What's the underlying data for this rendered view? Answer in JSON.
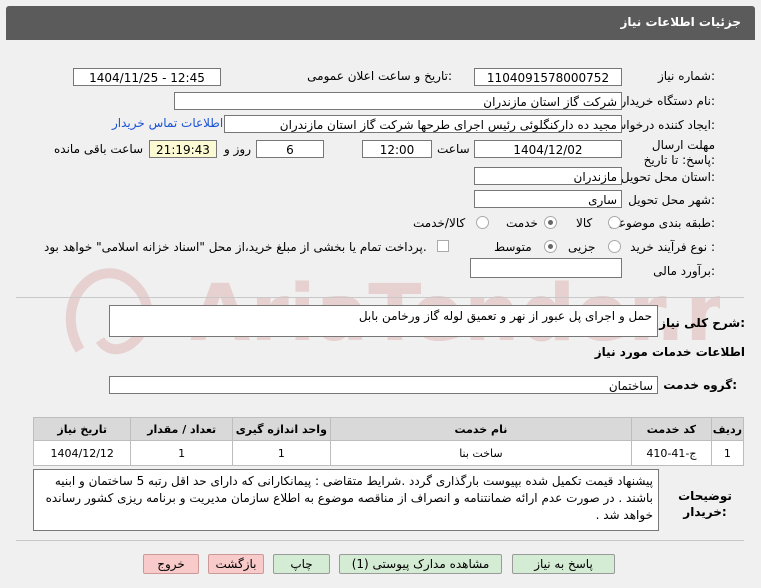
{
  "header": {
    "title": "جزئیات اطلاعات نیاز"
  },
  "fields": {
    "need_number_label": "شماره نیاز:",
    "need_number": "1104091578000752",
    "announce_label": "تاریخ و ساعت اعلان عمومی:",
    "announce_value": "1404/11/25 - 12:45",
    "buyer_org_label": "نام دستگاه خریدار:",
    "buyer_org": "شرکت گاز استان مازندران",
    "creator_label": "ایجاد کننده درخواست:",
    "creator": "مجید ده دارکنگلوئی رئیس اجرای طرحها شرکت گاز استان مازندران",
    "contact_link": "اطلاعات تماس خریدار",
    "deadline_label": "مهلت ارسال پاسخ: تا تاریخ:",
    "deadline_date": "1404/12/02",
    "time_label": "ساعت",
    "deadline_time": "12:00",
    "days_value": "6",
    "days_label": "روز و",
    "remaining_time": "21:19:43",
    "remaining_label": "ساعت باقی مانده",
    "province_label": "استان محل تحویل:",
    "province": "مازندران",
    "city_label": "شهر محل تحویل:",
    "city": "ساری",
    "category_label": "طبقه بندی موضوعی:",
    "category_options": [
      "کالا",
      "خدمت",
      "کالا/خدمت"
    ],
    "process_label": "نوع فرآیند خرید :",
    "process_options": [
      "جزیی",
      "متوسط"
    ],
    "payment_text": "پرداخت تمام یا بخشی از مبلغ خرید،از محل \"اسناد خزانه اسلامی\" خواهد بود.",
    "estimate_label": "برآورد مالی:",
    "estimate": ""
  },
  "description": {
    "label": "شرح کلی نیاز:",
    "value": "حمل و اجرای پل عبور از نهر و تعمیق لوله گاز ورخامن بابل"
  },
  "services": {
    "section_title": "اطلاعات خدمات مورد نیاز",
    "group_label": "گروه خدمت:",
    "group_value": "ساختمان",
    "columns": [
      "ردیف",
      "کد خدمت",
      "نام خدمت",
      "واحد اندازه گیری",
      "تعداد / مقدار",
      "تاریخ نیاز"
    ],
    "rows": [
      [
        "1",
        "ج-41-410",
        "ساخت بنا",
        "1",
        "1",
        "1404/12/12"
      ]
    ]
  },
  "notes": {
    "label": "توضیحات خریدار:",
    "value": "پیشنهاد قیمت تکمیل شده بپیوست  بارگذاری گردد .شرایط متقاضی : پیمانکارانی که دارای حد اقل رتبه 5 ساختمان و ابنیه باشند . در صورت عدم ارائه ضمانتنامه و انصراف از مناقصه موضوع به اطلاع سازمان مدیریت و برنامه ریزی کشور رسانده خواهد شد ."
  },
  "buttons": {
    "reply": "پاسخ به نیاز",
    "attachments": "مشاهده مدارک پیوستی (1)",
    "print": "چاپ",
    "back": "بازگشت",
    "exit": "خروج"
  },
  "watermark": "AriaTender.neT"
}
